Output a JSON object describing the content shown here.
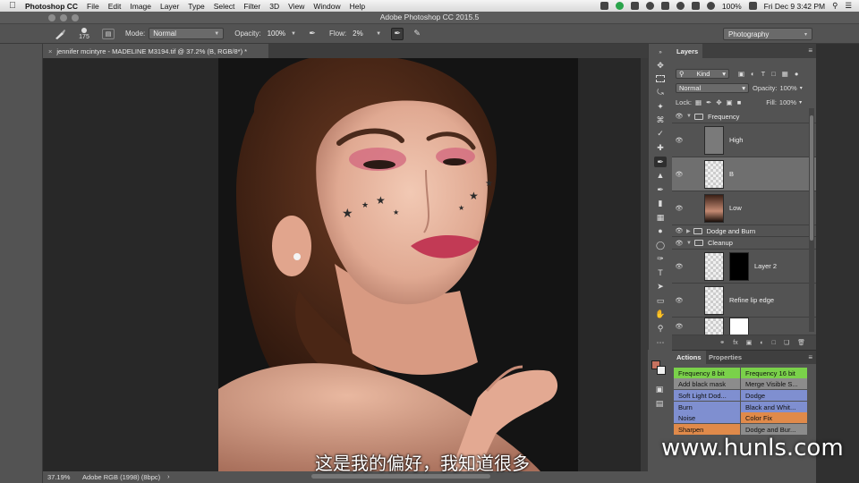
{
  "menubar": {
    "app": "Photoshop CC",
    "items": [
      "File",
      "Edit",
      "Image",
      "Layer",
      "Type",
      "Select",
      "Filter",
      "3D",
      "View",
      "Window",
      "Help"
    ],
    "battery": "100%",
    "clock": "Fri Dec 9  3:42 PM"
  },
  "window": {
    "title": "Adobe Photoshop CC 2015.5"
  },
  "options": {
    "brush_size": "175",
    "mode_label": "Mode:",
    "mode_value": "Normal",
    "opacity_label": "Opacity:",
    "opacity_value": "100%",
    "flow_label": "Flow:",
    "flow_value": "2%",
    "workspace": "Photography"
  },
  "document": {
    "tab": "jennifer mcintyre - MADELINE M3194.tif @ 37.2% (B, RGB/8*) *",
    "close": "×"
  },
  "status": {
    "zoom": "37.19%",
    "profile": "Adobe RGB (1998) (8bpc)",
    "arrow": "›"
  },
  "layers_panel": {
    "tab": "Layers",
    "filter_kind": "Kind",
    "blend_mode": "Normal",
    "opacity_label": "Opacity:",
    "opacity_value": "100%",
    "lock_label": "Lock:",
    "fill_label": "Fill:",
    "fill_value": "100%",
    "layers": {
      "frequency": "Frequency",
      "high": "High",
      "b": "B",
      "low": "Low",
      "dodge_burn": "Dodge and Burn",
      "cleanup": "Cleanup",
      "layer2": "Layer 2",
      "refine": "Refine lip edge"
    }
  },
  "actions_panel": {
    "tab_actions": "Actions",
    "tab_properties": "Properties",
    "buttons": [
      {
        "label": "Frequency 8 bit",
        "color": "#7ad14a"
      },
      {
        "label": "Frequency 16 bit",
        "color": "#7ad14a"
      },
      {
        "label": "Add black mask",
        "color": "#8c8c8c"
      },
      {
        "label": "Merge Visible S...",
        "color": "#8c8c8c"
      },
      {
        "label": "Soft Light Dod...",
        "color": "#7f8fd0"
      },
      {
        "label": "Dodge",
        "color": "#7f8fd0"
      },
      {
        "label": "Burn",
        "color": "#7f8fd0"
      },
      {
        "label": "Black and Whit...",
        "color": "#7f8fd0"
      },
      {
        "label": "Noise",
        "color": "#7f8fd0"
      },
      {
        "label": "Color Fix",
        "color": "#e08a4a"
      },
      {
        "label": "Sharpen",
        "color": "#e08a4a"
      },
      {
        "label": "Dodge and Bur...",
        "color": "#8c8c8c"
      }
    ]
  },
  "overlay": {
    "subtitle": "这是我的偏好，我知道很多",
    "watermark": "www.hunls.com"
  }
}
